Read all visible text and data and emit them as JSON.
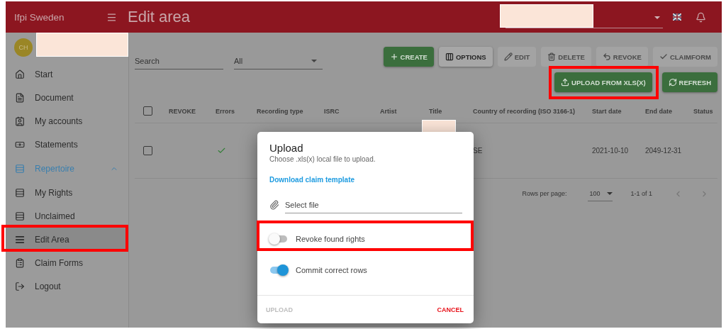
{
  "app_bar": {
    "brand": "Ifpi Sweden",
    "title": "Edit area",
    "account_select": {
      "redacted": true
    }
  },
  "sidebar": {
    "user": {
      "initials": "CH",
      "name_redacted": true
    },
    "items": [
      {
        "kind": "home",
        "label": "Start",
        "selected": false
      },
      {
        "kind": "document",
        "label": "Document",
        "selected": false
      },
      {
        "kind": "account",
        "label": "My accounts",
        "selected": false
      },
      {
        "kind": "money",
        "label": "Statements",
        "selected": false
      },
      {
        "kind": "list",
        "label": "Repertoire",
        "selected": false,
        "expanded": true,
        "children": [
          {
            "kind": "list",
            "label": "My Rights",
            "selected": false
          },
          {
            "kind": "list",
            "label": "Unclaimed",
            "selected": false
          },
          {
            "kind": "list",
            "label": "Edit Area",
            "selected": true,
            "highlighted": true
          }
        ]
      },
      {
        "kind": "form",
        "label": "Claim Forms",
        "selected": false
      },
      {
        "kind": "logout",
        "label": "Logout",
        "selected": false
      }
    ]
  },
  "toolbar": {
    "search": {
      "placeholder": "Search"
    },
    "filter": {
      "value": "All"
    },
    "buttons": [
      {
        "kind": "create",
        "label": "CREATE",
        "disabled": false
      },
      {
        "kind": "options",
        "label": "OPTIONS",
        "disabled": false
      },
      {
        "kind": "edit",
        "label": "EDIT",
        "disabled": true
      },
      {
        "kind": "delete",
        "label": "DELETE",
        "disabled": true
      },
      {
        "kind": "revoke",
        "label": "REVOKE",
        "disabled": true
      },
      {
        "kind": "claimform",
        "label": "CLAIMFORM",
        "disabled": true
      }
    ],
    "secondary_buttons": [
      {
        "kind": "upload",
        "label": "UPLOAD FROM XLS(X)",
        "disabled": false,
        "highlighted": true
      },
      {
        "kind": "refresh",
        "label": "REFRESH",
        "disabled": false
      }
    ]
  },
  "table": {
    "all_checked": false,
    "columns": [
      "REVOKE",
      "Errors",
      "Recording type",
      "ISRC",
      "Artist",
      "Title",
      "Country of recording (ISO 3166-1)",
      "Start date",
      "End date",
      "Status"
    ],
    "rows": [
      {
        "checked": false,
        "errors_ok": true,
        "title_redacted": true,
        "country": "SE",
        "start_date": "2021-10-10",
        "end_date": "2049-12-31"
      }
    ]
  },
  "pagination": {
    "label": "Rows per page:",
    "rows_per_page": "100",
    "range": "1-1 of 1"
  },
  "dialog": {
    "title": "Upload",
    "subtitle": "Choose .xls(x) local file to upload.",
    "link": "Download claim template",
    "file_field": {
      "placeholder": "Select file"
    },
    "toggles": [
      {
        "label": "Revoke found rights",
        "on": false,
        "highlighted": true
      },
      {
        "label": "Commit correct rows",
        "on": true
      }
    ],
    "actions": [
      {
        "kind": "confirm",
        "label": "UPLOAD",
        "disabled": true
      },
      {
        "kind": "cancel",
        "label": "CANCEL",
        "disabled": false
      }
    ]
  }
}
